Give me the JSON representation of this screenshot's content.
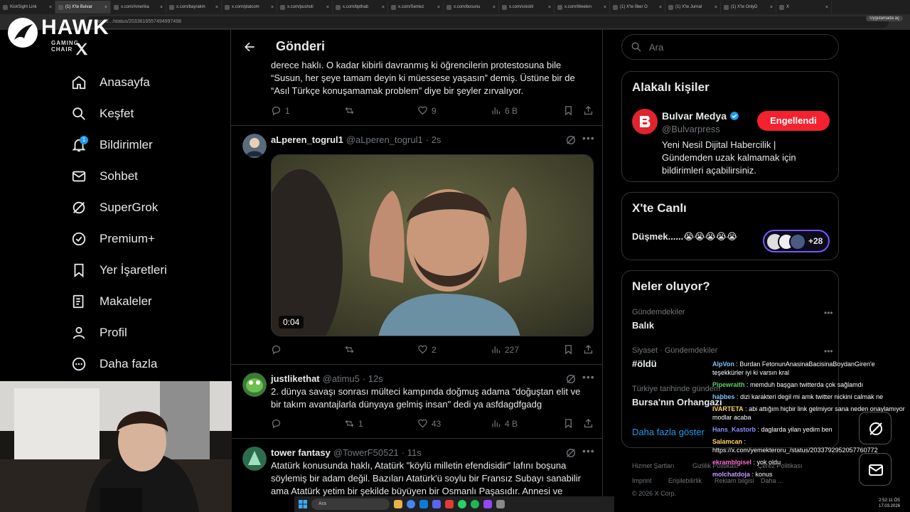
{
  "browser": {
    "tabs": [
      "KickSight Link",
      "(1) X'te Bulvar",
      "x.com/Amerika",
      "x.com/bayrakm",
      "x.com/platcom",
      "x.com/pusholi",
      "x.com/bpthab",
      "x.com/Sentez",
      "x.com/bosunu",
      "x.com/snickli",
      "x.com/Weelen",
      "(1) X'te İlber O",
      "(1) X'te Jurnal",
      "(1) X'te OnlyD",
      "X"
    ],
    "url": "x.com/.../status/2033616557494997498",
    "app_pill": "Uygulamada aç"
  },
  "overlay": {
    "logo_title": "HAWK",
    "logo_sub": "GAMING CHAIR"
  },
  "nav": {
    "items": [
      {
        "label": "Anasayfa",
        "icon": "home-icon"
      },
      {
        "label": "Keşfet",
        "icon": "search-icon"
      },
      {
        "label": "Bildirimler",
        "icon": "bell-icon",
        "badge": "1"
      },
      {
        "label": "Sohbet",
        "icon": "mail-icon"
      },
      {
        "label": "SuperGrok",
        "icon": "grok-icon"
      },
      {
        "label": "Premium+",
        "icon": "verified-icon"
      },
      {
        "label": "Yer İşaretleri",
        "icon": "bookmark-icon"
      },
      {
        "label": "Makaleler",
        "icon": "article-icon"
      },
      {
        "label": "Profil",
        "icon": "person-icon"
      },
      {
        "label": "Daha fazla",
        "icon": "more-circle-icon"
      }
    ]
  },
  "header": {
    "title": "Gönderi"
  },
  "tweets": [
    {
      "text_lines": [
        "derece haklı. O kadar kibirli davranmış ki öğrencilerin protestosuna bile",
        "“Susun, her şeye tamam deyin ki müessese yaşasın” demiş. Üstüne bir de",
        "“Asıl Türkçe konuşamamak problem” diye bir şeyler zırvalıyor."
      ],
      "replies": "1",
      "retweets": "",
      "likes": "9",
      "views": "6 B"
    },
    {
      "name": "aLperen_togrul1",
      "handle": "@aLperen_togrul1",
      "time": "· 2s",
      "video_time": "0:04",
      "replies": "",
      "retweets": "",
      "likes": "2",
      "views": "227"
    },
    {
      "name": "justlikethat",
      "handle": "@atimu5",
      "time": "· 12s",
      "text_lines": [
        "2. dünya savaşı sonrası mülteci kampında doğmuş adama \"doğuştan elit ve",
        "bir takım avantajlarla dünyaya gelmiş insan\" dedi ya asfdagdfgadg"
      ],
      "replies": "",
      "retweets": "1",
      "likes": "43",
      "views": "4 B"
    },
    {
      "name": "tower fantasy",
      "handle": "@TowerF50521",
      "time": "· 11s",
      "text_lines": [
        "Atatürk konusunda haklı, Atatürk \"köylü milletin efendisidir\" lafını boşuna",
        "söylemiş bir adam değil. Bazıları Atatürk'ü soylu bir Fransız Subayı sanabilir",
        "ama Atatürk yetim bir  şekilde büyüyen bir Osmanlı Paşasıdır. Annesi ve"
      ]
    }
  ],
  "search": {
    "placeholder": "Ara"
  },
  "related": {
    "title": "Alakalı kişiler",
    "name": "Bulvar Medya",
    "handle": "@Bulvarpress",
    "button": "Engellendi",
    "bio_lines": [
      "Yeni Nesil Dijital Habercilik |",
      "Gündemden uzak kalmamak için",
      "bildirimleri açabilirsiniz."
    ]
  },
  "live": {
    "title": "X'te Canlı",
    "text": "Düşmek......😭😭😭😭😭",
    "count": "+28"
  },
  "trends": {
    "title": "Neler oluyor?",
    "items": [
      {
        "category": "Gündemdekiler",
        "name": "Balık"
      },
      {
        "category": "Siyaset · Gündemdekiler",
        "name": "#öldü"
      },
      {
        "category": "Türkiye tarihinde gündem",
        "name": "Bursa'nın Orhangazi"
      }
    ],
    "show_more": "Daha fazla göster"
  },
  "footer": {
    "links": [
      "Hizmet Şartları",
      "Gizlilik Politikası",
      "Çerez Politikası",
      "Imprint",
      "Erişilebilirlik",
      "Reklam bilgisi",
      "Daha ...",
      "© 2026 X Corp."
    ]
  },
  "chat": [
    {
      "user": "AlpVon",
      "text": ": Burdan FetonunAnasinaBacisinaBoydanGiren'e teşekkürler iyi ki varsın kral",
      "color": "#7cc3ff"
    },
    {
      "user": "Pipewraith",
      "text": ": memduh başgan twitterda çok sağlamdı",
      "color": "#5bd16a"
    },
    {
      "user": "habbes",
      "text": ": dizi karakteri degil mi amk twitter nickini calmak ne",
      "color": "#7cc3ff"
    },
    {
      "user": "IVARTETA",
      "text": ": abi attığım hiçbir link gelmiyor sana neden onaylamıyor modlar acaba",
      "color": "#ffd75e"
    },
    {
      "user": "Hans_Kastorb",
      "text": ": daglarda yilan yedim ben",
      "color": "#8a8cff"
    },
    {
      "user": "Salamcan",
      "text": ": https://x.com/yemekteroru_/status/2033792952057760772",
      "color": "#ffd75e"
    },
    {
      "user": "ekramblgisel",
      "text": ": yok oldu",
      "color": "#ff6bd0"
    },
    {
      "user": "molchatdoja",
      "text": ": konus",
      "color": "#c99bff"
    }
  ],
  "taskbar": {
    "search": "Ara"
  },
  "clock": {
    "time": "2:52:11 ÖS",
    "date": "17.03.2026"
  },
  "colors": {
    "accent": "#1d9bf0",
    "block": "#f4212e",
    "border": "#2f3336",
    "muted": "#71767b"
  }
}
